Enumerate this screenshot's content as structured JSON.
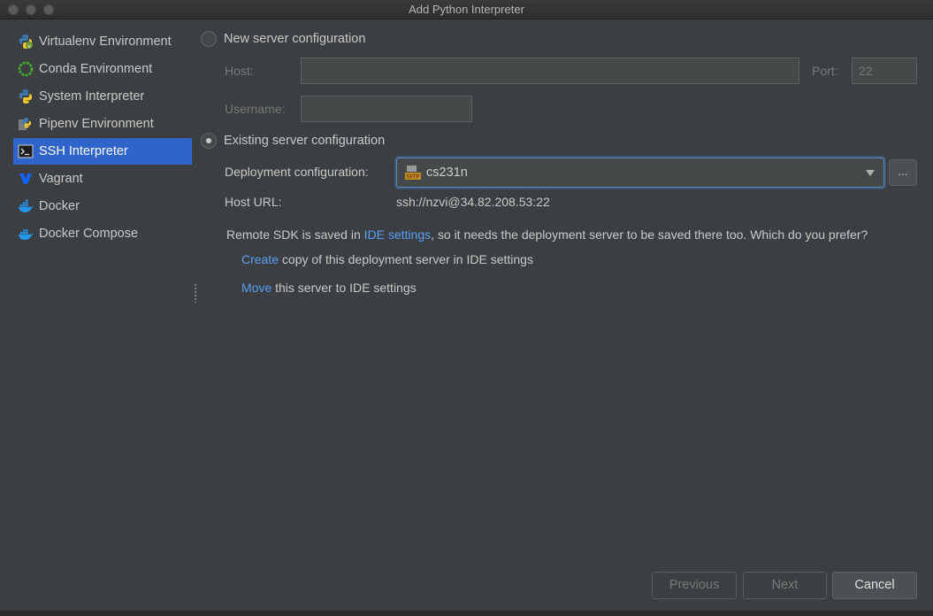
{
  "window": {
    "title": "Add Python Interpreter"
  },
  "sidebar": {
    "items": [
      {
        "label": "Virtualenv Environment",
        "icon": "virtualenv-icon"
      },
      {
        "label": "Conda Environment",
        "icon": "conda-icon"
      },
      {
        "label": "System Interpreter",
        "icon": "python-icon"
      },
      {
        "label": "Pipenv Environment",
        "icon": "pipenv-icon"
      },
      {
        "label": "SSH Interpreter",
        "icon": "ssh-terminal-icon"
      },
      {
        "label": "Vagrant",
        "icon": "vagrant-icon"
      },
      {
        "label": "Docker",
        "icon": "docker-icon"
      },
      {
        "label": "Docker Compose",
        "icon": "docker-compose-icon"
      }
    ],
    "selected": "SSH Interpreter"
  },
  "new_server": {
    "label": "New server configuration",
    "host_label": "Host:",
    "host_value": "",
    "port_label": "Port:",
    "port_value": "22",
    "username_label": "Username:",
    "username_value": ""
  },
  "existing_server": {
    "label": "Existing server configuration",
    "deployment_label": "Deployment configuration:",
    "deployment_value": "cs231n",
    "deployment_icon_text": "SFTP",
    "browse_label": "...",
    "host_url_label": "Host URL:",
    "host_url_value": "ssh://nzvi@34.82.208.53:22"
  },
  "notice": {
    "prefix": "Remote SDK is saved in ",
    "link": "IDE settings",
    "suffix": ", so it needs the deployment server to be saved there too. Which do you prefer?"
  },
  "options": {
    "create_link": "Create",
    "create_text": " copy of this deployment server in IDE settings",
    "move_link": "Move",
    "move_text": " this server to IDE settings"
  },
  "buttons": {
    "previous": "Previous",
    "next": "Next",
    "cancel": "Cancel"
  },
  "colors": {
    "background": "#3c3f41",
    "selection": "#2f65ca",
    "link": "#589df6",
    "focus": "#5d86b8"
  }
}
